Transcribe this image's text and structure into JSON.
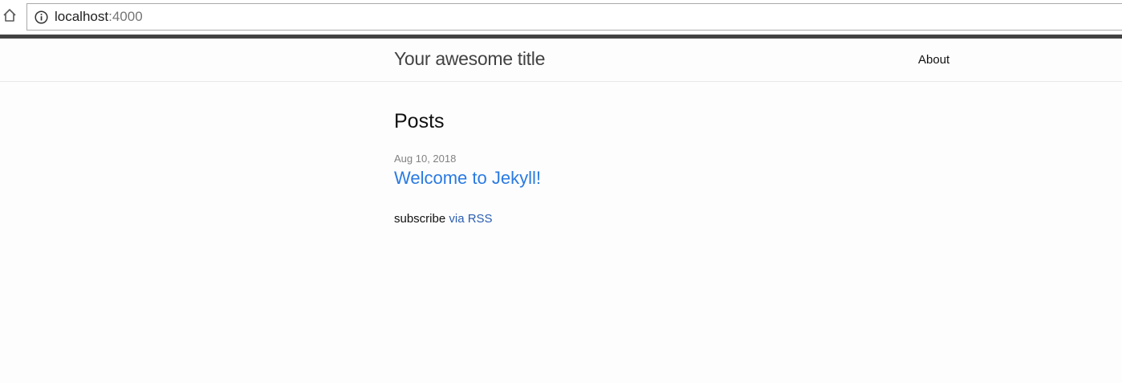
{
  "browser": {
    "url_host": "localhost",
    "url_port": ":4000"
  },
  "header": {
    "site_title": "Your awesome title",
    "nav": [
      {
        "label": "About"
      }
    ]
  },
  "main": {
    "heading": "Posts",
    "posts": [
      {
        "date": "Aug 10, 2018",
        "title": "Welcome to Jekyll!"
      }
    ],
    "subscribe_text": "subscribe",
    "rss_link_label": "via RSS"
  },
  "colors": {
    "link": "#2a7ae2",
    "rss_link": "#2a5db0",
    "header_border": "#424242",
    "meta": "#828282"
  },
  "icons": [
    "home-icon",
    "info-icon"
  ]
}
